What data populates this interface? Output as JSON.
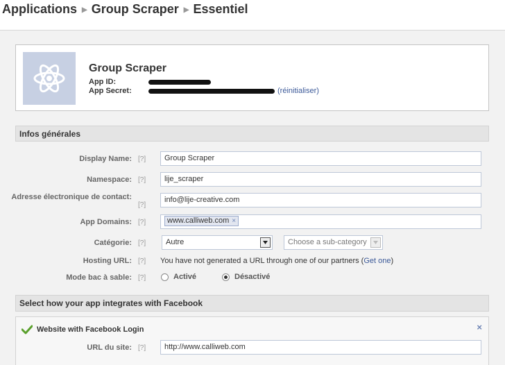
{
  "breadcrumb": [
    "Applications",
    "Group Scraper",
    "Essentiel"
  ],
  "app": {
    "name": "Group Scraper",
    "id_label": "App ID:",
    "secret_label": "App Secret:",
    "reset_link": "(réinitialiser)"
  },
  "sections": {
    "general": "Infos générales",
    "integration": "Select how your app integrates with Facebook"
  },
  "help_marker": "[?]",
  "form": {
    "display_name": {
      "label": "Display Name:",
      "value": "Group Scraper"
    },
    "namespace": {
      "label": "Namespace:",
      "value": "lije_scraper"
    },
    "contact_email": {
      "label_line1": "Adresse électronique de contact:",
      "value": "info@lije-creative.com"
    },
    "app_domains": {
      "label": "App Domains:",
      "token": "www.calliweb.com",
      "remove": "×"
    },
    "category": {
      "label": "Catégorie:",
      "value": "Autre",
      "sub_placeholder": "Choose a sub-category"
    },
    "hosting_url": {
      "label": "Hosting URL:",
      "text": "You have not generated a URL through one of our partners (",
      "link": "Get one",
      "text_end": ")"
    },
    "sandbox": {
      "label": "Mode bac à sable:",
      "option_on": "Activé",
      "option_off": "Désactivé",
      "selected": "Désactivé"
    }
  },
  "integration": {
    "title": "Website with Facebook Login",
    "close": "×",
    "site_url": {
      "label": "URL du site:",
      "value": "http://www.calliweb.com"
    }
  },
  "colors": {
    "link": "#3b5998",
    "check": "#5aa02c",
    "icon_bg": "#c7d0e3"
  }
}
